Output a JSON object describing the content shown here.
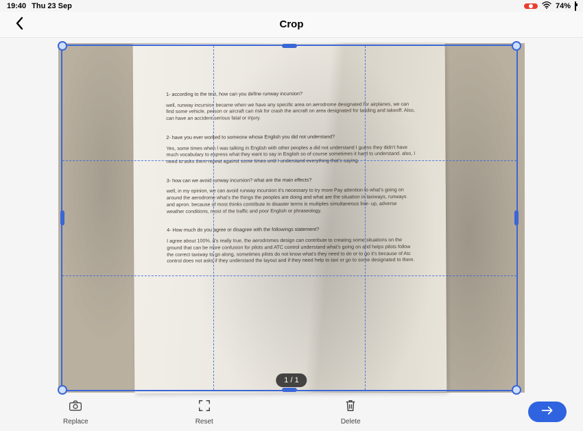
{
  "status": {
    "time": "19:40",
    "date": "Thu 23 Sep",
    "battery_pct": "74%"
  },
  "header": {
    "title": "Crop"
  },
  "page_indicator": "1 / 1",
  "toolbar": {
    "replace": "Replace",
    "reset": "Reset",
    "delete": "Delete"
  },
  "document": {
    "q1": "1- according to the text, how can you define runway incursion?",
    "a1": "well, runway incursion became when we have any specific area on aerodrome designated for airplanes, we can find some vehicle, person or aircraft can risk for crash the aircraft on area designated for landing and takeoff. Also, can have an accident serious fatal or injury.",
    "q2": "2- have you ever worked to someone whose English you did not understand?",
    "a2": "Yes, some times when I was talking in English with other peoples a did not understand I guess they didn't have much vocabulary to express what they want to say in English so of course sometimes it hard to understand. also, I need to asks them repeat against some times until I understand everything that's saying.",
    "q3": "3- how can we avoid runway incursion? what are the main effects?",
    "a3": "well, in my opinion, we can avoid runway incursion it's necessary to try more Pay attention to what's going on around the aerodrome what's the things the peoples are doing and what are the situation in taxiways, runways and apron. because of most thinks contribute to disaster terms is multiples simultaneous line- up, adverse weather conditions, most of the traffic and poor English or phraseology.",
    "q4": "4- How much do you agree or disagree with the followings statement?",
    "a4": "I agree about 100%. it's really true, the aerodromes design can contribute to creating some situations on the ground that can be more confusion for pilots and ATC control understand what's going on and helps pilots follow the correct taxiway to go along, sometimes pilots do not know what's they need to do or to go it's because of Atc control does not asks if they understand the layout and if they need help to taxi or go to some designated to them."
  }
}
